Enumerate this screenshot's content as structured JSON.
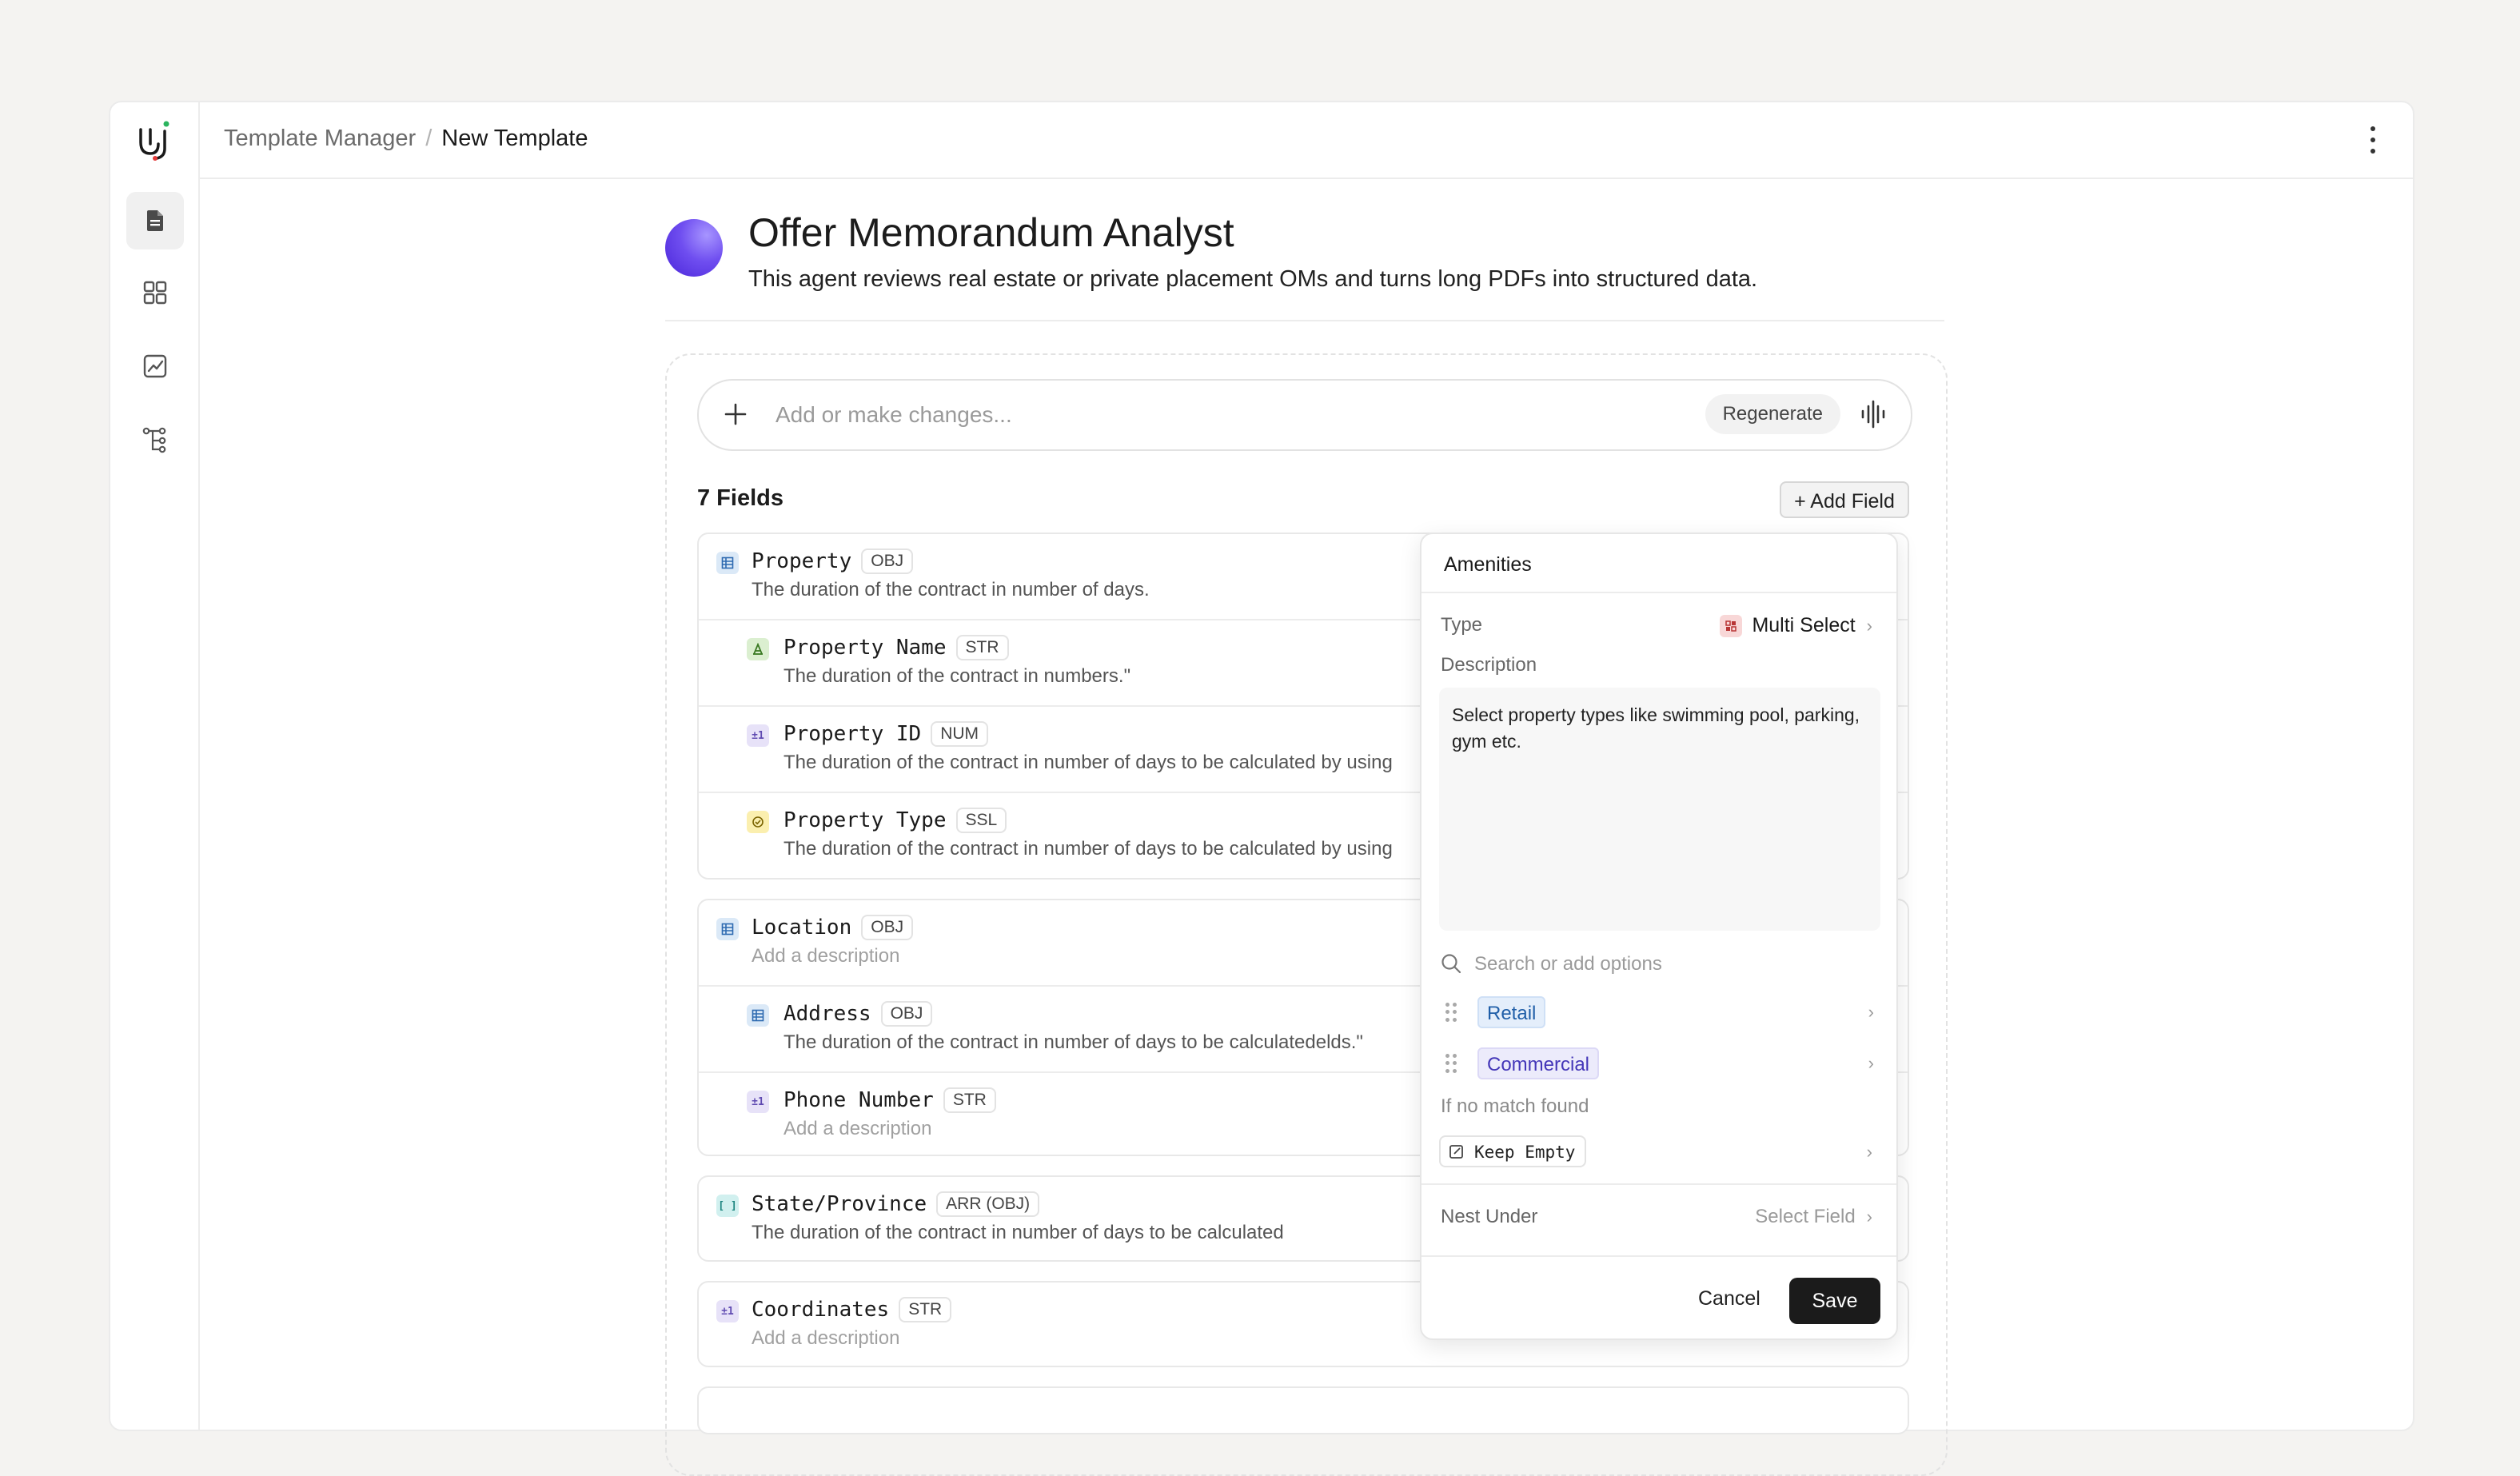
{
  "breadcrumb": {
    "parent": "Template Manager",
    "separator": "/",
    "current": "New Template"
  },
  "agent": {
    "title": "Offer Memorandum Analyst",
    "description": "This agent reviews real estate or private placement OMs and turns long PDFs into structured data."
  },
  "prompt": {
    "placeholder": "Add or make changes...",
    "regenerate": "Regenerate"
  },
  "fields_header": {
    "count_label": "7 Fields",
    "add_field": "+ Add Field"
  },
  "groups": [
    {
      "rows": [
        {
          "name": "Property",
          "type": "OBJ",
          "icon": "table-icon",
          "desc": "The duration of the contract in number of days."
        },
        {
          "name": "Property Name",
          "type": "STR",
          "icon": "text-icon",
          "desc": "The duration of the contract in numbers.\""
        },
        {
          "name": "Property ID",
          "type": "NUM",
          "icon": "number-icon",
          "desc": "The duration of the contract in number of days to be calculated by using"
        },
        {
          "name": "Property Type",
          "type": "SSL",
          "icon": "check-circle-icon",
          "desc": "The duration of the contract in number of days to be calculated by using"
        }
      ]
    },
    {
      "rows": [
        {
          "name": "Location",
          "type": "OBJ",
          "icon": "table-icon",
          "desc": "Add a description"
        },
        {
          "name": "Address",
          "type": "OBJ",
          "icon": "table-icon",
          "desc": "The duration of the contract in number of days to be calculatedelds.\""
        },
        {
          "name": "Phone Number",
          "type": "STR",
          "icon": "number-icon",
          "desc": "Add a description"
        }
      ]
    },
    {
      "rows": [
        {
          "name": "State/Province",
          "type": "ARR (OBJ)",
          "icon": "array-icon",
          "desc": "The duration of the contract in number of days to be calculated"
        }
      ]
    },
    {
      "rows": [
        {
          "name": "Coordinates",
          "type": "STR",
          "icon": "number-icon",
          "desc": "Add a description"
        }
      ]
    }
  ],
  "editor": {
    "title": "Amenities",
    "type_label": "Type",
    "type_value": "Multi Select",
    "description_label": "Description",
    "description_value": "Select property types like swimming pool, parking, gym etc.",
    "search_placeholder": "Search or add options",
    "options": [
      "Retail",
      "Commercial"
    ],
    "no_match_label": "If no match found",
    "no_match_value": "Keep Empty",
    "nest_label": "Nest Under",
    "nest_value": "Select Field",
    "cancel": "Cancel",
    "save": "Save"
  }
}
